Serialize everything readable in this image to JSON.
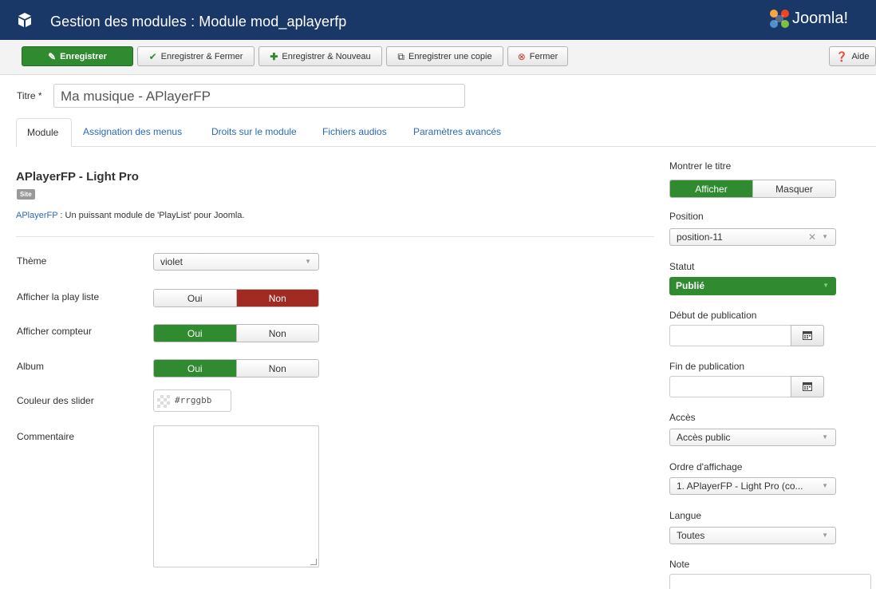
{
  "header": {
    "title": "Gestion des modules : Module mod_aplayerfp",
    "logo": "Joomla!"
  },
  "toolbar": {
    "save": "Enregistrer",
    "save_close": "Enregistrer & Fermer",
    "save_new": "Enregistrer & Nouveau",
    "save_copy": "Enregistrer une copie",
    "close": "Fermer",
    "help": "Aide"
  },
  "titre": {
    "label": "Titre *",
    "value": "Ma musique - APlayerFP"
  },
  "tabs": [
    "Module",
    "Assignation des menus",
    "Droits sur le module",
    "Fichiers audios",
    "Paramètres avancés"
  ],
  "module": {
    "name": "APlayerFP - Light Pro",
    "badge": "Site",
    "desc_link": "APlayerFP",
    "desc_text": " : Un puissant module de 'PlayList' pour Joomla."
  },
  "fields": {
    "theme": {
      "label": "Thème",
      "value": "violet"
    },
    "playlist": {
      "label": "Afficher la play liste",
      "yes": "Oui",
      "no": "Non",
      "selected": "Non"
    },
    "compteur": {
      "label": "Afficher compteur",
      "yes": "Oui",
      "no": "Non",
      "selected": "Oui"
    },
    "album": {
      "label": "Album",
      "yes": "Oui",
      "no": "Non",
      "selected": "Oui"
    },
    "couleur": {
      "label": "Couleur des slider",
      "placeholder": "#rrggbb"
    },
    "commentaire": {
      "label": "Commentaire",
      "value": ""
    }
  },
  "sidebar": {
    "montrer_titre": {
      "label": "Montrer le titre",
      "show": "Afficher",
      "hide": "Masquer",
      "selected": "Afficher"
    },
    "position": {
      "label": "Position",
      "value": "position-11"
    },
    "statut": {
      "label": "Statut",
      "value": "Publié"
    },
    "debut": {
      "label": "Début de publication",
      "value": ""
    },
    "fin": {
      "label": "Fin de publication",
      "value": ""
    },
    "acces": {
      "label": "Accès",
      "value": "Accès public"
    },
    "ordre": {
      "label": "Ordre d'affichage",
      "value": "1. APlayerFP - Light Pro (co..."
    },
    "langue": {
      "label": "Langue",
      "value": "Toutes"
    },
    "note": {
      "label": "Note",
      "value": ""
    }
  },
  "colors": {
    "header_bg": "#1a3867",
    "green": "#2f8a30",
    "red": "#a12b22",
    "link": "#2a69b8"
  },
  "icons": [
    "cube-icon",
    "edit-icon",
    "check-icon",
    "plus-icon",
    "copy-icon",
    "close-circle-icon",
    "question-circle-icon",
    "calendar-icon",
    "joomla-logo"
  ]
}
